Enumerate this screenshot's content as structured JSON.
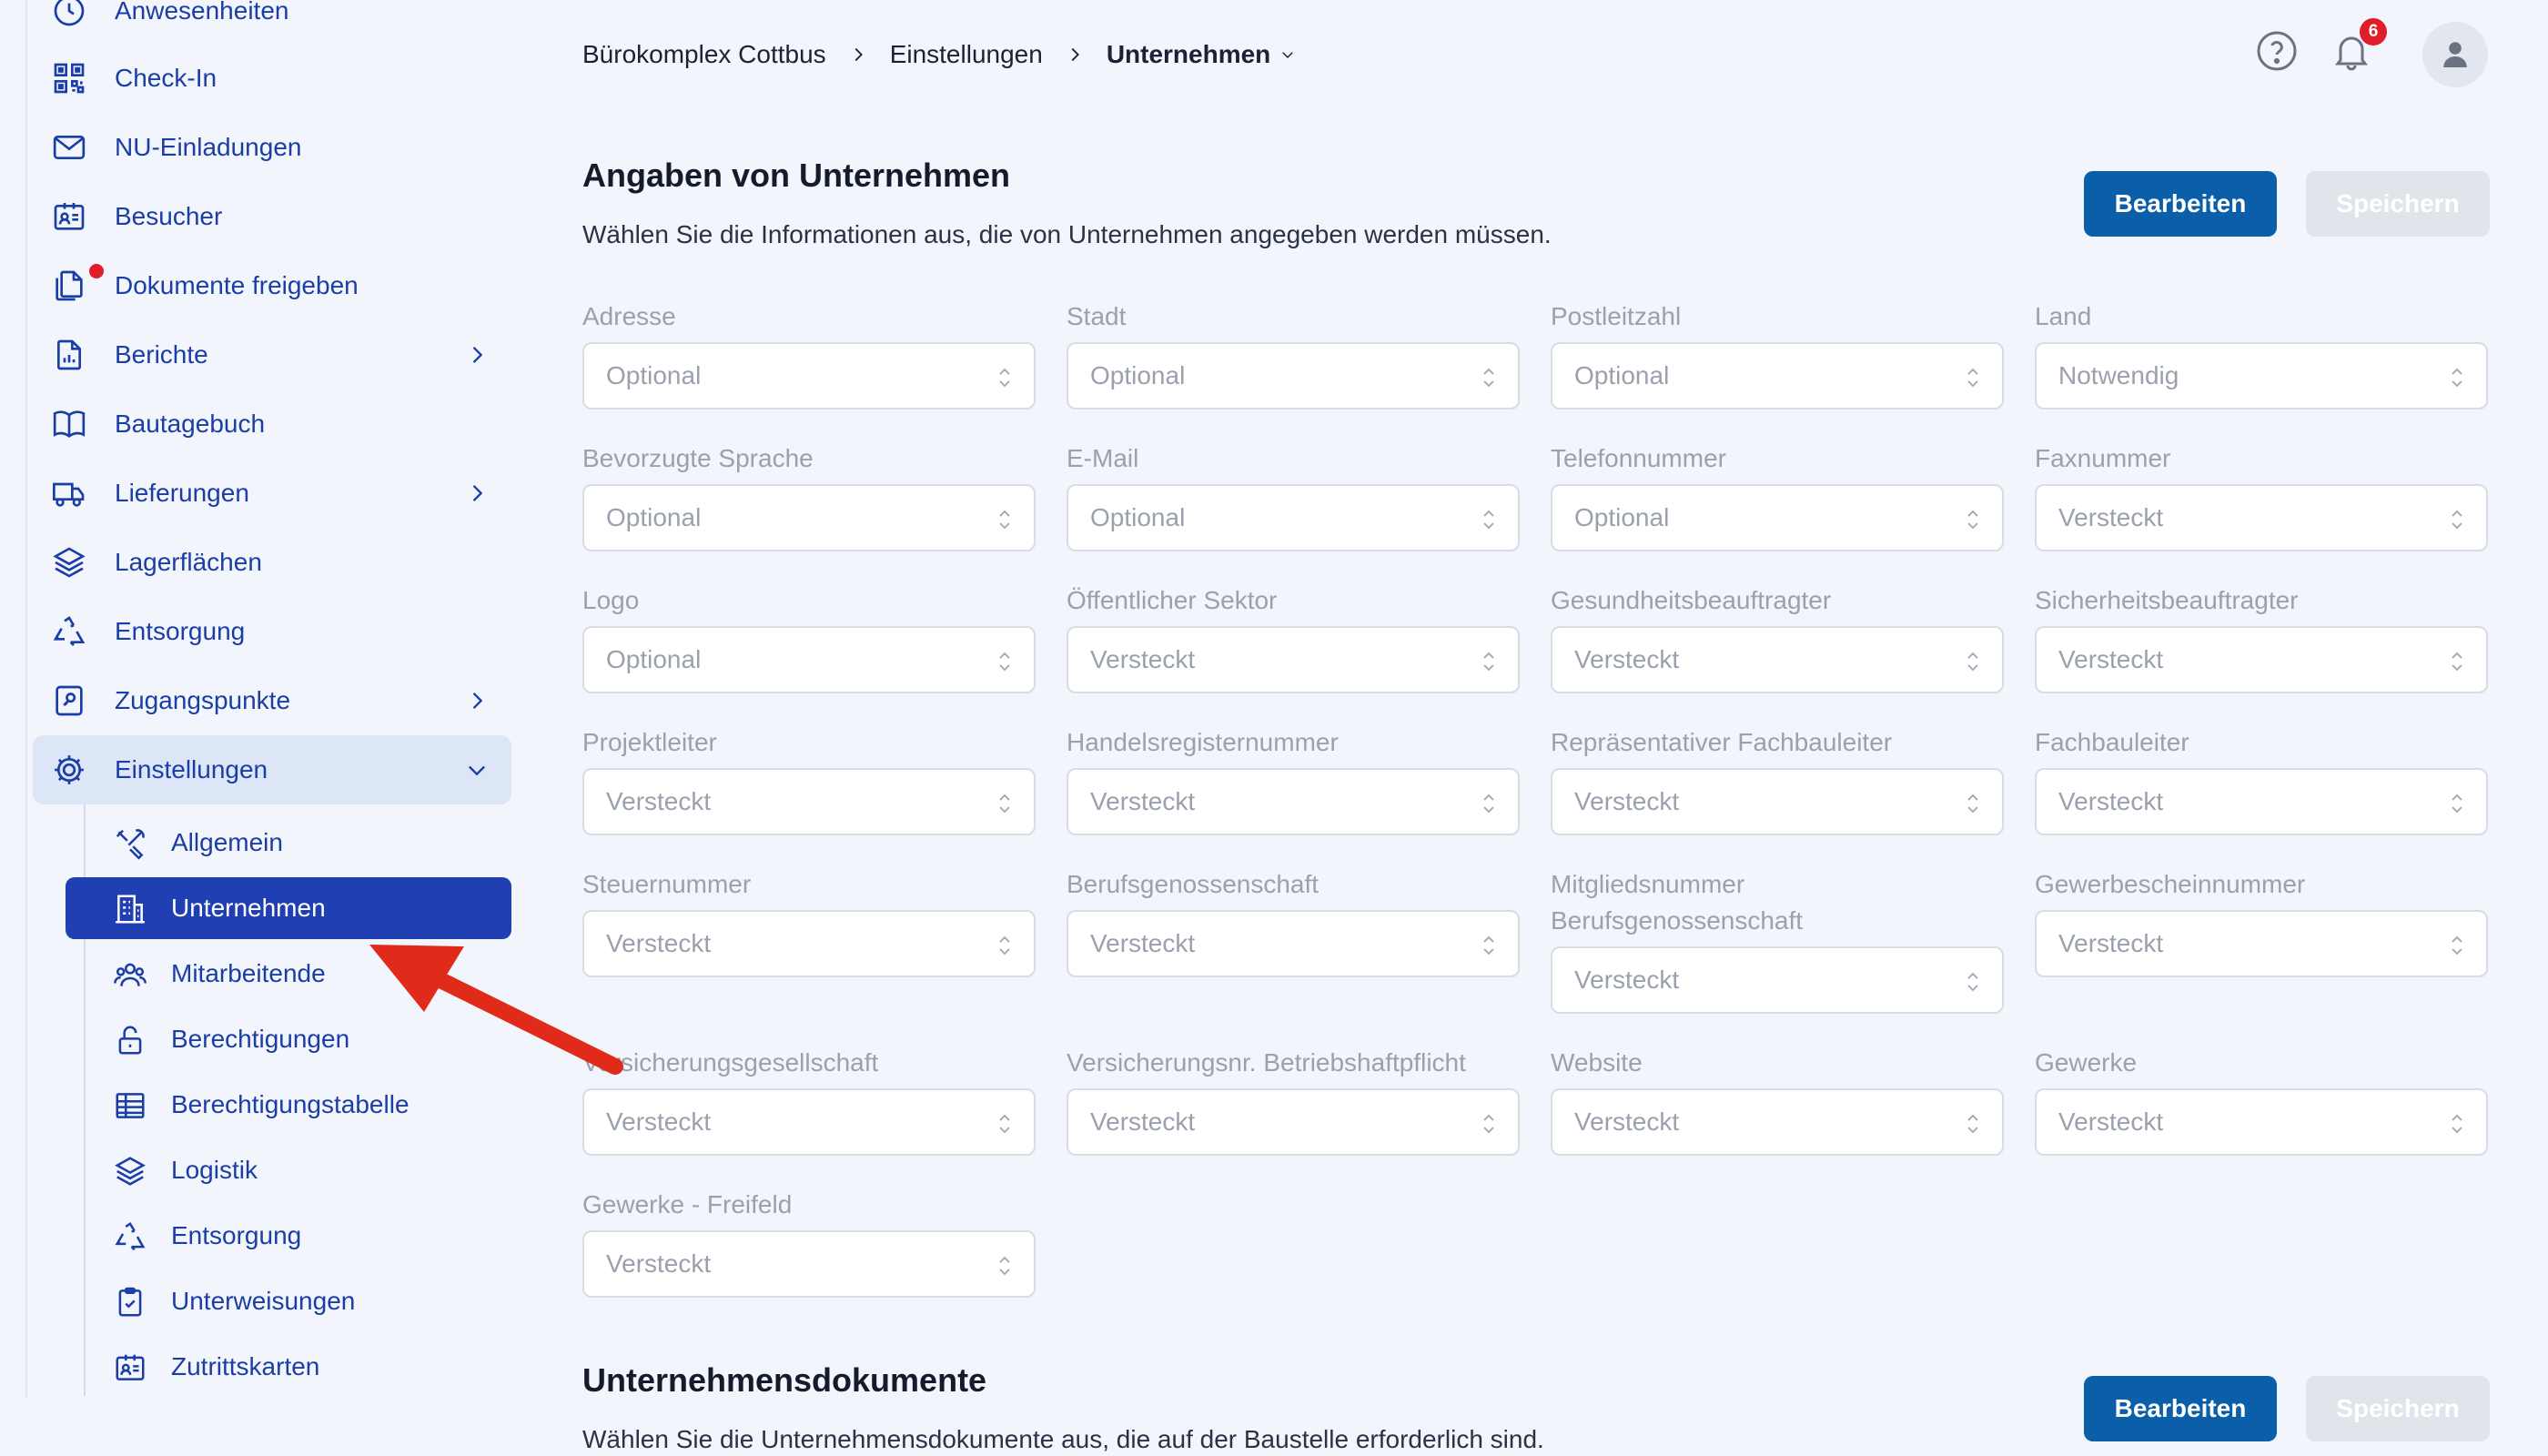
{
  "colors": {
    "accent": "#1b3ea6",
    "active_bg": "#1f3fb3",
    "primary_button": "#0b5ea8",
    "badge": "#e11d2a",
    "annotation_arrow": "#e02a1a"
  },
  "sidebar": {
    "items": [
      {
        "label": "Anwesenheiten",
        "icon": "clock-icon"
      },
      {
        "label": "Check-In",
        "icon": "qr-code-icon"
      },
      {
        "label": "NU-Einladungen",
        "icon": "envelope-icon"
      },
      {
        "label": "Besucher",
        "icon": "visitor-badge-icon"
      },
      {
        "label": "Dokumente freigeben",
        "icon": "documents-icon"
      },
      {
        "label": "Berichte",
        "icon": "report-icon"
      },
      {
        "label": "Bautagebuch",
        "icon": "book-icon"
      },
      {
        "label": "Lieferungen",
        "icon": "truck-icon"
      },
      {
        "label": "Lagerflächen",
        "icon": "layers-icon"
      },
      {
        "label": "Entsorgung",
        "icon": "recycle-icon"
      },
      {
        "label": "Zugangspunkte",
        "icon": "key-card-icon"
      },
      {
        "label": "Einstellungen",
        "icon": "gear-icon"
      }
    ],
    "settings_items": [
      {
        "label": "Allgemein",
        "icon": "tools-icon"
      },
      {
        "label": "Unternehmen",
        "icon": "building-icon"
      },
      {
        "label": "Mitarbeitende",
        "icon": "users-icon"
      },
      {
        "label": "Berechtigungen",
        "icon": "lock-icon"
      },
      {
        "label": "Berechtigungstabelle",
        "icon": "table-icon"
      },
      {
        "label": "Logistik",
        "icon": "layers-icon"
      },
      {
        "label": "Entsorgung",
        "icon": "recycle-icon"
      },
      {
        "label": "Unterweisungen",
        "icon": "clipboard-icon"
      },
      {
        "label": "Zutrittskarten",
        "icon": "id-card-icon"
      }
    ]
  },
  "breadcrumb": {
    "project": "Bürokomplex Cottbus",
    "section": "Einstellungen",
    "current": "Unternehmen"
  },
  "header": {
    "notifications_count": "6"
  },
  "company_fields": {
    "title": "Angaben von Unternehmen",
    "description": "Wählen Sie die Informationen aus, die von Unternehmen angegeben werden müssen.",
    "edit_label": "Bearbeiten",
    "save_label": "Speichern",
    "fields": [
      {
        "label": "Adresse",
        "value": "Optional"
      },
      {
        "label": "Stadt",
        "value": "Optional"
      },
      {
        "label": "Postleitzahl",
        "value": "Optional"
      },
      {
        "label": "Land",
        "value": "Notwendig"
      },
      {
        "label": "Bevorzugte Sprache",
        "value": "Optional"
      },
      {
        "label": "E-Mail",
        "value": "Optional"
      },
      {
        "label": "Telefonnummer",
        "value": "Optional"
      },
      {
        "label": "Faxnummer",
        "value": "Versteckt"
      },
      {
        "label": "Logo",
        "value": "Optional"
      },
      {
        "label": "Öffentlicher Sektor",
        "value": "Versteckt"
      },
      {
        "label": "Gesundheitsbeauftragter",
        "value": "Versteckt"
      },
      {
        "label": "Sicherheitsbeauftragter",
        "value": "Versteckt"
      },
      {
        "label": "Projektleiter",
        "value": "Versteckt"
      },
      {
        "label": "Handelsregisternummer",
        "value": "Versteckt"
      },
      {
        "label": "Repräsentativer Fachbauleiter",
        "value": "Versteckt"
      },
      {
        "label": "Fachbauleiter",
        "value": "Versteckt"
      },
      {
        "label": "Steuernummer",
        "value": "Versteckt"
      },
      {
        "label": "Berufsgenossenschaft",
        "value": "Versteckt"
      },
      {
        "label": "Mitgliedsnummer Berufsgenossenschaft",
        "value": "Versteckt"
      },
      {
        "label": "Gewerbescheinnummer",
        "value": "Versteckt"
      },
      {
        "label": "Versicherungsgesellschaft",
        "value": "Versteckt"
      },
      {
        "label": "Versicherungsnr. Betriebshaftpflicht",
        "value": "Versteckt"
      },
      {
        "label": "Website",
        "value": "Versteckt"
      },
      {
        "label": "Gewerke",
        "value": "Versteckt"
      },
      {
        "label": "Gewerke - Freifeld",
        "value": "Versteckt"
      }
    ]
  },
  "company_documents": {
    "title": "Unternehmensdokumente",
    "description": "Wählen Sie die Unternehmensdokumente aus, die auf der Baustelle erforderlich sind.",
    "edit_label": "Bearbeiten",
    "save_label": "Speichern"
  }
}
